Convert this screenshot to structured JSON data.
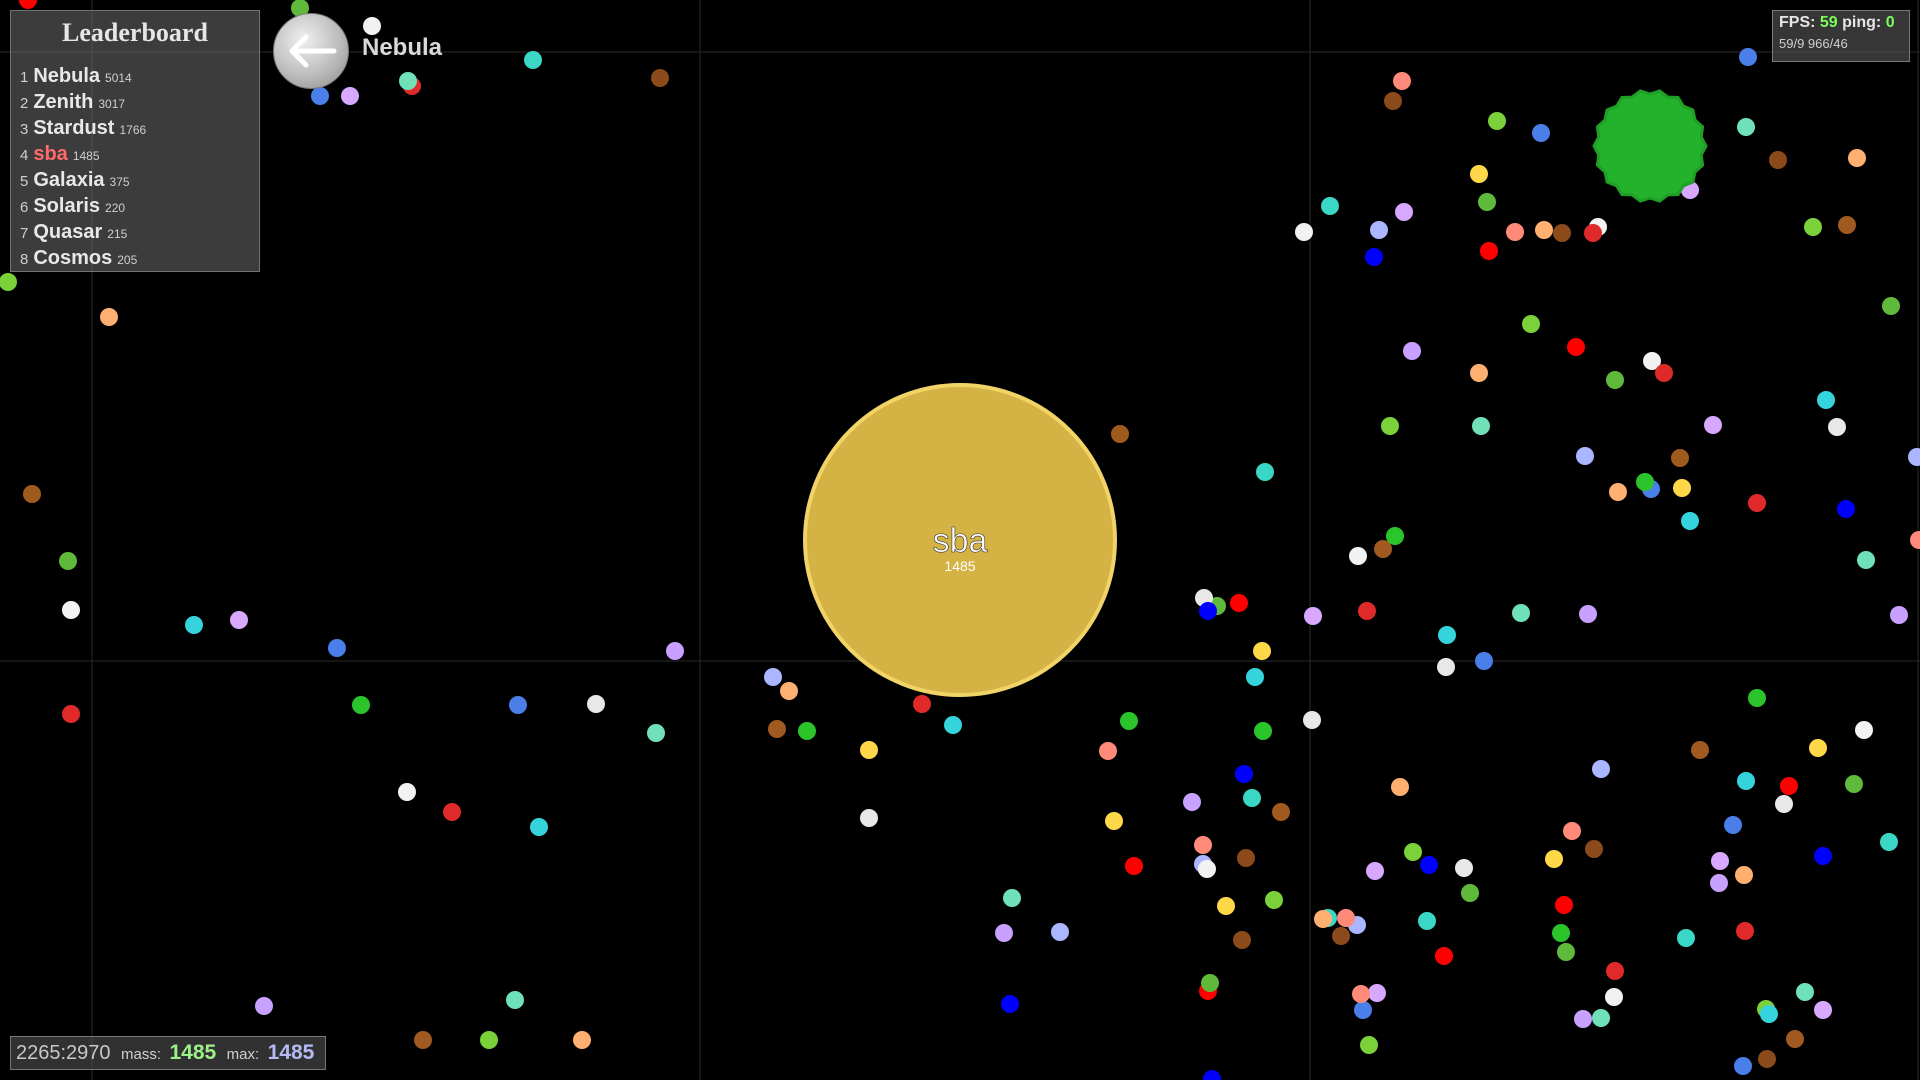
{
  "leaderboard": {
    "title": "Leaderboard",
    "entries": [
      {
        "rank": "1",
        "name": "Nebula",
        "mass": "5014"
      },
      {
        "rank": "2",
        "name": "Zenith",
        "mass": "3017"
      },
      {
        "rank": "3",
        "name": "Stardust",
        "mass": "1766"
      },
      {
        "rank": "4",
        "name": "sba",
        "mass": "1485",
        "is_self": true
      },
      {
        "rank": "5",
        "name": "Galaxia",
        "mass": "375"
      },
      {
        "rank": "6",
        "name": "Solaris",
        "mass": "220"
      },
      {
        "rank": "7",
        "name": "Quasar",
        "mass": "215"
      },
      {
        "rank": "8",
        "name": "Cosmos",
        "mass": "205"
      }
    ]
  },
  "spectate": {
    "name": "Nebula",
    "icon": "back-arrow-icon"
  },
  "stats": {
    "fps_label": "FPS:",
    "fps": "59",
    "ping_label": "ping:",
    "ping": "0",
    "line2": "59/9 966/46"
  },
  "player_cell": {
    "name": "sba",
    "mass": "1485",
    "color": "#d4b244",
    "border_color": "#f1d467"
  },
  "status": {
    "coords": "2265:2970",
    "mass_label": "mass:",
    "mass": "1485",
    "max_label": "max:",
    "max": "1485"
  },
  "virus": {
    "color": "#24b12c"
  },
  "colors": {
    "background": "#000000",
    "grid": "#2a2a2a",
    "accent_self": "#ff6a6a",
    "fps_value": "#7cfc5a",
    "mass_value": "#9df08a",
    "max_value": "#b7b9f5"
  }
}
